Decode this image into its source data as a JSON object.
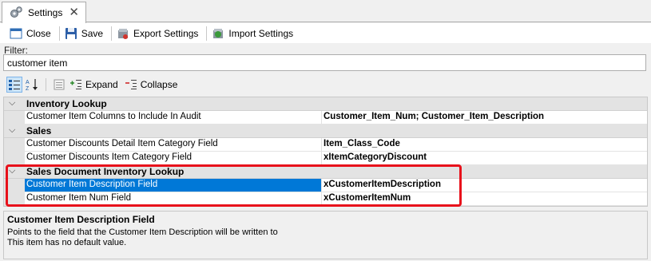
{
  "tab": {
    "title": "Settings",
    "close_glyph": "✕"
  },
  "toolbar": {
    "close_label": "Close",
    "save_label": "Save",
    "export_label": "Export Settings",
    "import_label": "Import Settings"
  },
  "filter": {
    "label": "Filter:",
    "value": "customer item"
  },
  "grid_toolbar": {
    "expand_label": "Expand",
    "collapse_label": "Collapse",
    "sort_label": "AZ"
  },
  "categories": [
    {
      "label": "Inventory Lookup",
      "properties": [
        {
          "name": "Customer Item Columns to Include In Audit",
          "value": "Customer_Item_Num; Customer_Item_Description"
        }
      ]
    },
    {
      "label": "Sales",
      "properties": [
        {
          "name": "Customer Discounts Detail Item Category Field",
          "value": "Item_Class_Code"
        },
        {
          "name": "Customer Discounts Item Category Field",
          "value": "xItemCategoryDiscount"
        }
      ]
    },
    {
      "label": "Sales Document Inventory Lookup",
      "properties": [
        {
          "name": "Customer Item Description Field",
          "value": "xCustomerItemDescription",
          "selected": true
        },
        {
          "name": "Customer Item Num Field",
          "value": "xCustomerItemNum"
        }
      ]
    }
  ],
  "description": {
    "title": "Customer Item Description Field",
    "line1": "Points to the field that the Customer Item Description will be written to",
    "line2": "This item has no default value."
  },
  "colors": {
    "selection": "#0078d7",
    "highlight": "#e8111b",
    "category_bg": "#e3e3e3"
  },
  "icons": [
    "gear-icon",
    "close-icon",
    "window-icon",
    "save-icon",
    "export-icon",
    "import-icon",
    "categorized-icon",
    "alphabetical-icon",
    "property-pages-icon",
    "expand-icon",
    "collapse-icon",
    "chevron-down-icon"
  ]
}
